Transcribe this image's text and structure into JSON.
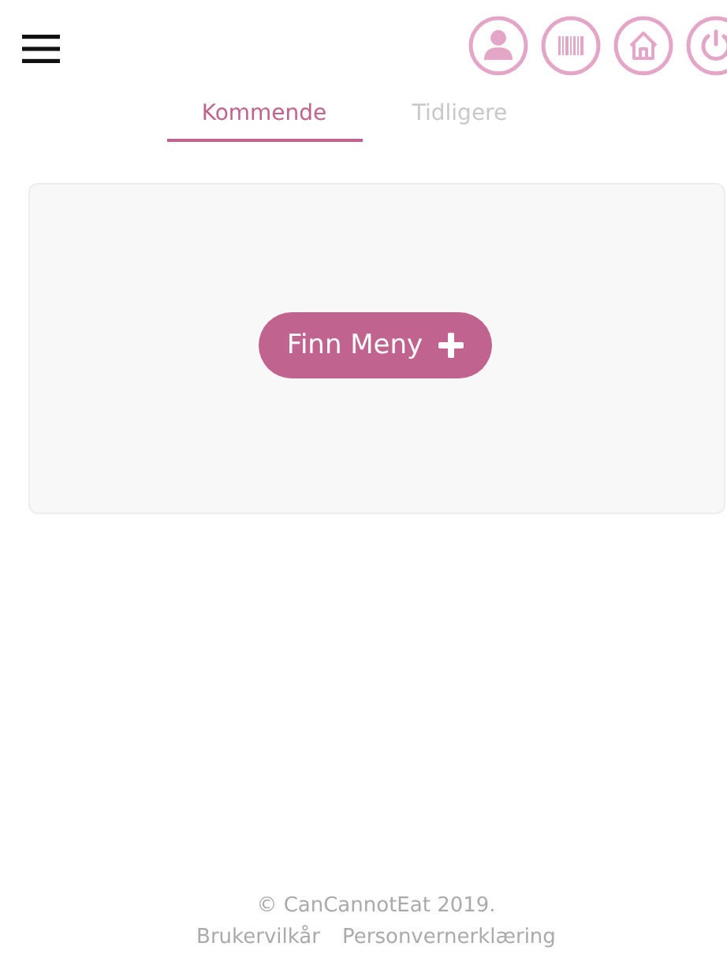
{
  "tabs": [
    {
      "label": "Kommende",
      "selected": true
    },
    {
      "label": "Tidligere",
      "selected": false
    }
  ],
  "card": {
    "button": "Finn Meny"
  },
  "footer": {
    "copyright": "© CanCannotEat 2019.",
    "links": [
      "Brukervilkår",
      "Personvernerklæring"
    ]
  }
}
